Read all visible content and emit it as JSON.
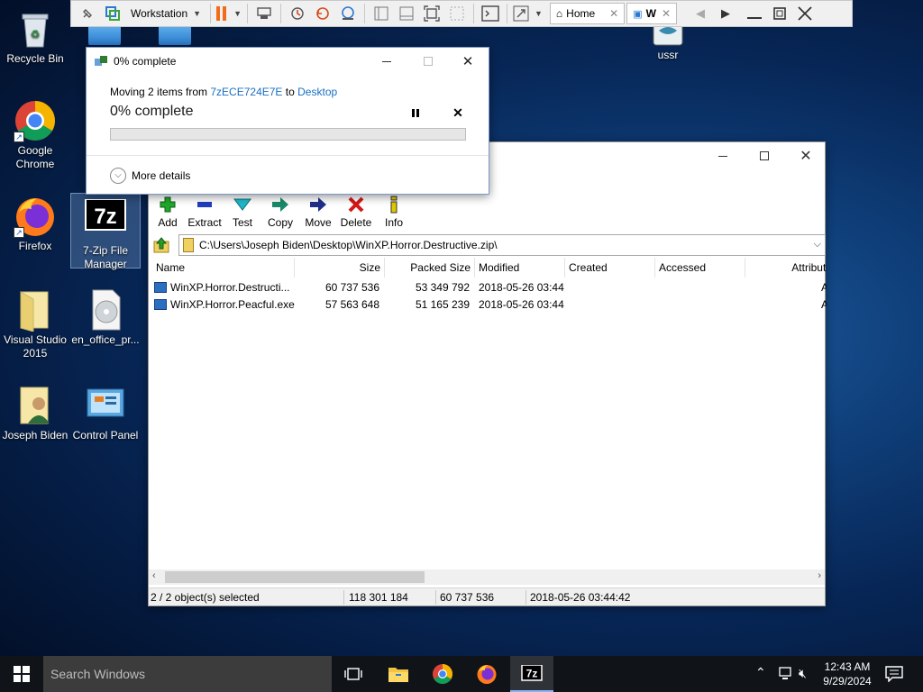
{
  "desktop": {
    "icons": [
      {
        "label": "Recycle Bin"
      },
      {
        "label": "Google Chrome"
      },
      {
        "label": "Firefox"
      },
      {
        "label": "7-Zip File Manager"
      },
      {
        "label": "Visual Studio 2015"
      },
      {
        "label": "en_office_pr..."
      },
      {
        "label": "Joseph Biden"
      },
      {
        "label": "Control Panel"
      },
      {
        "label": "ussr"
      }
    ]
  },
  "vmware": {
    "vm_name": "Workstation",
    "tabs": [
      {
        "label": "Home"
      },
      {
        "label": "W"
      }
    ]
  },
  "progress_dialog": {
    "title": "0% complete",
    "moving_prefix": "Moving 2 items from",
    "source": "7zECE724E7E",
    "to_word": "to",
    "destination": "Desktop",
    "status": "0% complete",
    "progress_percent": 0,
    "more_details": "More details"
  },
  "sevenzip": {
    "toolbar": [
      {
        "label": "Add",
        "icon": "plus-icon",
        "color": "#1fa82b"
      },
      {
        "label": "Extract",
        "icon": "minus-icon",
        "color": "#1f3fbf"
      },
      {
        "label": "Test",
        "icon": "check-icon",
        "color": "#1fb8c8"
      },
      {
        "label": "Copy",
        "icon": "copy-arrow-icon",
        "color": "#1a8a6a"
      },
      {
        "label": "Move",
        "icon": "move-arrow-icon",
        "color": "#1f2f8a"
      },
      {
        "label": "Delete",
        "icon": "delete-x-icon",
        "color": "#d41818"
      },
      {
        "label": "Info",
        "icon": "info-icon",
        "color": "#e0c800"
      }
    ],
    "address": "C:\\Users\\Joseph Biden\\Desktop\\WinXP.Horror.Destructive.zip\\",
    "columns": [
      "Name",
      "Size",
      "Packed Size",
      "Modified",
      "Created",
      "Accessed",
      "Attribute"
    ],
    "files": [
      {
        "name": "WinXP.Horror.Destructi...",
        "size": "60 737 536",
        "packed": "53 349 792",
        "modified": "2018-05-26 03:44",
        "attr": "A"
      },
      {
        "name": "WinXP.Horror.Peacful.exe",
        "size": "57 563 648",
        "packed": "51 165 239",
        "modified": "2018-05-26 03:44",
        "attr": "A"
      }
    ],
    "status": {
      "selected": "2 / 2 object(s) selected",
      "total": "118 301 184",
      "size": "60 737 536",
      "date": "2018-05-26 03:44:42"
    }
  },
  "taskbar": {
    "search_placeholder": "Search Windows",
    "time": "12:43 AM",
    "date": "9/29/2024"
  }
}
